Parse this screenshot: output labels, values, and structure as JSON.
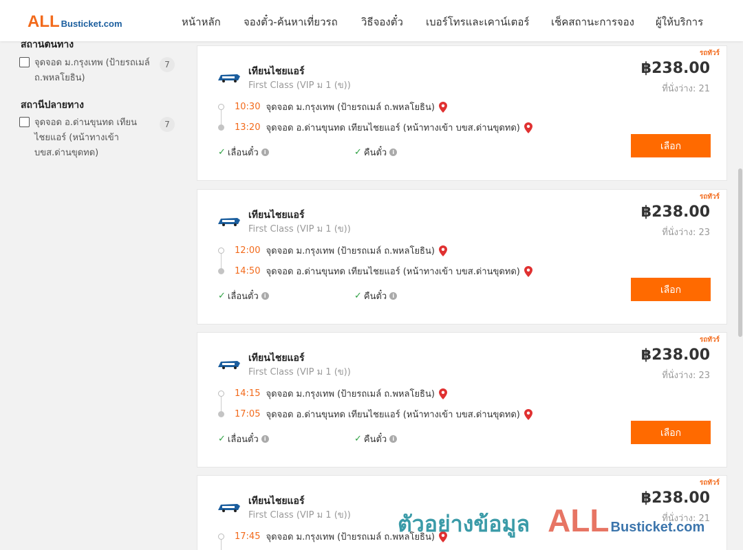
{
  "header": {
    "logo_all": "ALL",
    "logo_rest": "Busticket.com",
    "nav": [
      "หน้าหลัก",
      "จองตั๋ว-ค้นหาเที่ยวรถ",
      "วิธีจองตั๋ว",
      "เบอร์โทรและเคาน์เตอร์",
      "เช็คสถานะการจอง",
      "ผู้ให้บริการ"
    ]
  },
  "sidebar": {
    "origin_heading": "สถานีต้นทาง",
    "origin_option": {
      "label": "จุดจอด ม.กรุงเทพ (ป้ายรถเมล์ ถ.พหลโยธิน)",
      "count": "7",
      "checked": false
    },
    "dest_heading": "สถานีปลายทาง",
    "dest_option": {
      "label": "จุดจอด อ.ด่านขุนทด เทียนไชยแอร์ (หน้าทางเข้า บขส.ด่านขุดทด)",
      "count": "7",
      "checked": false
    }
  },
  "colors": {
    "accent": "#ff6a00",
    "time": "#f26a1b",
    "check": "#2ea043",
    "pin": "#e03131",
    "watermark_text": "#1a8a9a",
    "watermark_all": "#e35d4a"
  },
  "trips": [
    {
      "badge": "รถทัวร์",
      "operator": "เทียนไชยแอร์",
      "class": "First Class (VIP ม 1 (ข))",
      "price": "฿238.00",
      "seats": "ที่นั่งว่าง: 21",
      "depart_time": "10:30",
      "depart_stop": "จุดจอด ม.กรุงเทพ (ป้ายรถเมล์ ถ.พหลโยธิน)",
      "arrive_time": "13:20",
      "arrive_stop": "จุดจอด อ.ด่านขุนทด เทียนไชยแอร์ (หน้าทางเข้า บขส.ด่านขุดทด)",
      "feature1": "เลื่อนตั๋ว",
      "feature2": "คืนตั๋ว",
      "button": "เลือก"
    },
    {
      "badge": "รถทัวร์",
      "operator": "เทียนไชยแอร์",
      "class": "First Class (VIP ม 1 (ข))",
      "price": "฿238.00",
      "seats": "ที่นั่งว่าง: 23",
      "depart_time": "12:00",
      "depart_stop": "จุดจอด ม.กรุงเทพ (ป้ายรถเมล์ ถ.พหลโยธิน)",
      "arrive_time": "14:50",
      "arrive_stop": "จุดจอด อ.ด่านขุนทด เทียนไชยแอร์ (หน้าทางเข้า บขส.ด่านขุดทด)",
      "feature1": "เลื่อนตั๋ว",
      "feature2": "คืนตั๋ว",
      "button": "เลือก"
    },
    {
      "badge": "รถทัวร์",
      "operator": "เทียนไชยแอร์",
      "class": "First Class (VIP ม 1 (ข))",
      "price": "฿238.00",
      "seats": "ที่นั่งว่าง: 23",
      "depart_time": "14:15",
      "depart_stop": "จุดจอด ม.กรุงเทพ (ป้ายรถเมล์ ถ.พหลโยธิน)",
      "arrive_time": "17:05",
      "arrive_stop": "จุดจอด อ.ด่านขุนทด เทียนไชยแอร์ (หน้าทางเข้า บขส.ด่านขุดทด)",
      "feature1": "เลื่อนตั๋ว",
      "feature2": "คืนตั๋ว",
      "button": "เลือก"
    },
    {
      "badge": "รถทัวร์",
      "operator": "เทียนไชยแอร์",
      "class": "First Class (VIP ม 1 (ข))",
      "price": "฿238.00",
      "seats": "ที่นั่งว่าง: 21",
      "depart_time": "17:45",
      "depart_stop": "จุดจอด ม.กรุงเทพ (ป้ายรถเมล์ ถ.พหลโยธิน)"
    }
  ],
  "watermark": {
    "text": "ตัวอย่างข้อมูล",
    "all": "ALL",
    "rest": "Busticket.com"
  }
}
